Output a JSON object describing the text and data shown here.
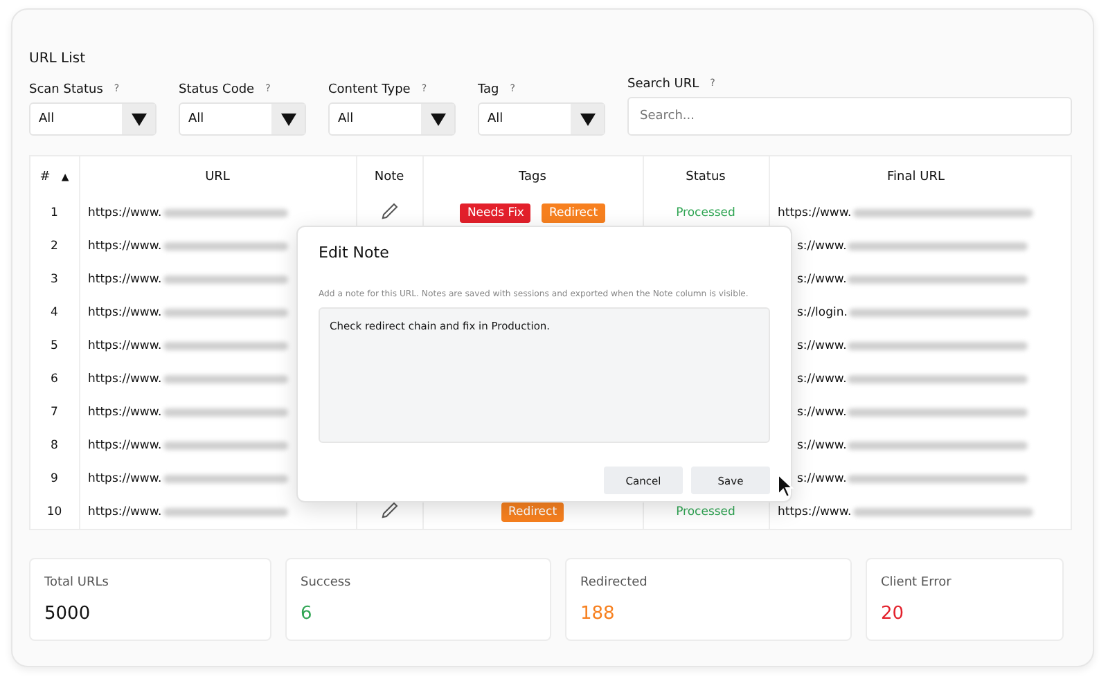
{
  "panel": {
    "title": "URL List"
  },
  "filters": [
    {
      "label": "Scan Status",
      "help": "?",
      "value": "All"
    },
    {
      "label": "Status Code",
      "help": "?",
      "value": "All"
    },
    {
      "label": "Content Type",
      "help": "?",
      "value": "All"
    },
    {
      "label": "Tag",
      "help": "?",
      "value": "All"
    }
  ],
  "search": {
    "label": "Search URL",
    "help": "?",
    "placeholder": "Search..."
  },
  "table": {
    "columns": [
      "#",
      "URL",
      "Note",
      "Tags",
      "Status",
      "Final URL"
    ],
    "sort_mark": "▲",
    "rows": [
      {
        "num": "1",
        "url": "https://www.",
        "note_button": true,
        "tags": [
          {
            "label": "Needs Fix",
            "color": "#e3202b"
          },
          {
            "label": "Redirect",
            "color": "#f7801f"
          }
        ],
        "status": {
          "text": "Processed",
          "color": "#2fa553"
        },
        "final_url": "https://www."
      },
      {
        "num": "2",
        "url": "https://www.",
        "final_url": "s://www."
      },
      {
        "num": "3",
        "url": "https://www.",
        "final_url": "s://www."
      },
      {
        "num": "4",
        "url": "https://www.",
        "final_url": "s://login."
      },
      {
        "num": "5",
        "url": "https://www.",
        "final_url": "s://www."
      },
      {
        "num": "6",
        "url": "https://www.",
        "final_url": "s://www."
      },
      {
        "num": "7",
        "url": "https://www.",
        "final_url": "s://www."
      },
      {
        "num": "8",
        "url": "https://www.",
        "final_url": "s://www."
      },
      {
        "num": "9",
        "url": "https://www.",
        "final_url": "s://www."
      },
      {
        "num": "10",
        "url": "https://www.",
        "note_button": true,
        "tags": [
          {
            "label": "Redirect",
            "color": "#f7801f"
          }
        ],
        "status": {
          "text": "Processed",
          "color": "#2fa553"
        },
        "final_url": "https://www."
      }
    ]
  },
  "dialog": {
    "title": "Edit Note",
    "description": "Add a note for this URL. Notes are saved with sessions and exported when the Note column is visible.",
    "value": "Check redirect chain and fix in Production.",
    "buttons": [
      "Cancel",
      "Save"
    ]
  },
  "stats": [
    {
      "label": "Total URLs",
      "value": "5000",
      "color": "#111111"
    },
    {
      "label": "Success",
      "value": "6",
      "color": "#2fa553"
    },
    {
      "label": "Redirected",
      "value": "188",
      "color": "#f7801f"
    },
    {
      "label": "Client Error",
      "value": "20",
      "color": "#e3202b"
    }
  ]
}
